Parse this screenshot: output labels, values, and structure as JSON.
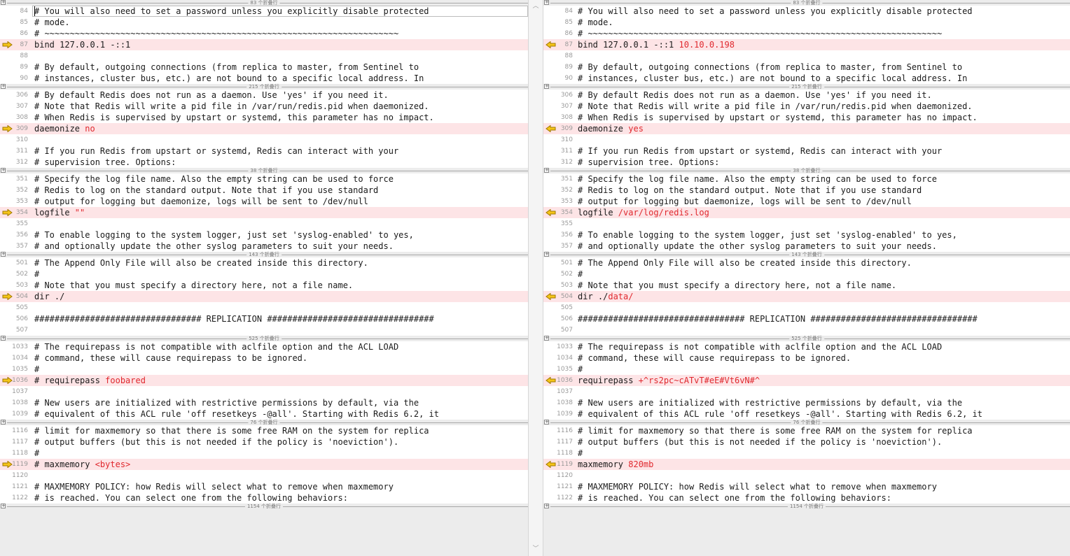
{
  "panes": {
    "left": {
      "segments": [
        {
          "folded": "83 个折叠行",
          "rows": [
            {
              "n": "84",
              "t": "# You will also need to set a password unless you explicitly disable protected",
              "d": false
            },
            {
              "n": "85",
              "t": "# mode.",
              "d": false
            },
            {
              "n": "86",
              "t": "# ~~~~~~~~~~~~~~~~~~~~~~~~~~~~~~~~~~~~~~~~~~~~~~~~~~~~~~~~~~~~~~~~~~~~~~",
              "d": false
            },
            {
              "n": "87",
              "t": "bind 127.0.0.1 -::1",
              "h": "",
              "d": true
            },
            {
              "n": "88",
              "t": "",
              "d": false
            },
            {
              "n": "89",
              "t": "# By default, outgoing connections (from replica to master, from Sentinel to",
              "d": false
            },
            {
              "n": "90",
              "t": "# instances, cluster bus, etc.) are not bound to a specific local address. In",
              "d": false
            }
          ]
        },
        {
          "folded": "215 个折叠行",
          "rows": [
            {
              "n": "306",
              "t": "# By default Redis does not run as a daemon. Use 'yes' if you need it.",
              "d": false
            },
            {
              "n": "307",
              "t": "# Note that Redis will write a pid file in /var/run/redis.pid when daemonized.",
              "d": false
            },
            {
              "n": "308",
              "t": "# When Redis is supervised by upstart or systemd, this parameter has no impact.",
              "d": false
            },
            {
              "n": "309",
              "t": "daemonize ",
              "h": "no",
              "d": true
            },
            {
              "n": "310",
              "t": "",
              "d": false
            },
            {
              "n": "311",
              "t": "# If you run Redis from upstart or systemd, Redis can interact with your",
              "d": false
            },
            {
              "n": "312",
              "t": "# supervision tree. Options:",
              "d": false
            }
          ]
        },
        {
          "folded": "38 个折叠行",
          "rows": [
            {
              "n": "351",
              "t": "# Specify the log file name. Also the empty string can be used to force",
              "d": false
            },
            {
              "n": "352",
              "t": "# Redis to log on the standard output. Note that if you use standard",
              "d": false
            },
            {
              "n": "353",
              "t": "# output for logging but daemonize, logs will be sent to /dev/null",
              "d": false
            },
            {
              "n": "354",
              "t": "logfile ",
              "h": "\"\"",
              "d": true
            },
            {
              "n": "355",
              "t": "",
              "d": false
            },
            {
              "n": "356",
              "t": "# To enable logging to the system logger, just set 'syslog-enabled' to yes,",
              "d": false
            },
            {
              "n": "357",
              "t": "# and optionally update the other syslog parameters to suit your needs.",
              "d": false
            }
          ]
        },
        {
          "folded": "143 个折叠行",
          "rows": [
            {
              "n": "501",
              "t": "# The Append Only File will also be created inside this directory.",
              "d": false
            },
            {
              "n": "502",
              "t": "#",
              "d": false
            },
            {
              "n": "503",
              "t": "# Note that you must specify a directory here, not a file name.",
              "d": false
            },
            {
              "n": "504",
              "t": "dir ./",
              "h": "",
              "d": true
            },
            {
              "n": "505",
              "t": "",
              "d": false
            },
            {
              "n": "506",
              "t": "################################# REPLICATION #################################",
              "d": false
            },
            {
              "n": "507",
              "t": "",
              "d": false
            }
          ]
        },
        {
          "folded": "525 个折叠行",
          "rows": [
            {
              "n": "1033",
              "t": "# The requirepass is not compatible with aclfile option and the ACL LOAD",
              "d": false
            },
            {
              "n": "1034",
              "t": "# command, these will cause requirepass to be ignored.",
              "d": false
            },
            {
              "n": "1035",
              "t": "#",
              "d": false
            },
            {
              "n": "1036",
              "t": "# requirepass ",
              "h": "foobared",
              "d": true
            },
            {
              "n": "1037",
              "t": "",
              "d": false
            },
            {
              "n": "1038",
              "t": "# New users are initialized with restrictive permissions by default, via the",
              "d": false
            },
            {
              "n": "1039",
              "t": "# equivalent of this ACL rule 'off resetkeys -@all'. Starting with Redis 6.2, it",
              "d": false
            }
          ]
        },
        {
          "folded": "76 个折叠行",
          "rows": [
            {
              "n": "1116",
              "t": "# limit for maxmemory so that there is some free RAM on the system for replica",
              "d": false
            },
            {
              "n": "1117",
              "t": "# output buffers (but this is not needed if the policy is 'noeviction').",
              "d": false
            },
            {
              "n": "1118",
              "t": "#",
              "d": false
            },
            {
              "n": "1119",
              "t": "# maxmemory ",
              "h": "<bytes>",
              "d": true
            },
            {
              "n": "1120",
              "t": "",
              "d": false
            },
            {
              "n": "1121",
              "t": "# MAXMEMORY POLICY: how Redis will select what to remove when maxmemory",
              "d": false
            },
            {
              "n": "1122",
              "t": "# is reached. You can select one from the following behaviors:",
              "d": false
            }
          ]
        }
      ],
      "tail_folded": "1154 个折叠行"
    },
    "right": {
      "segments": [
        {
          "folded": "83 个折叠行",
          "rows": [
            {
              "n": "84",
              "t": "# You will also need to set a password unless you explicitly disable protected",
              "d": false
            },
            {
              "n": "85",
              "t": "# mode.",
              "d": false
            },
            {
              "n": "86",
              "t": "# ~~~~~~~~~~~~~~~~~~~~~~~~~~~~~~~~~~~~~~~~~~~~~~~~~~~~~~~~~~~~~~~~~~~~~~",
              "d": false
            },
            {
              "n": "87",
              "t": "bind 127.0.0.1 -::1 ",
              "h": "10.10.0.198",
              "d": true
            },
            {
              "n": "88",
              "t": "",
              "d": false
            },
            {
              "n": "89",
              "t": "# By default, outgoing connections (from replica to master, from Sentinel to",
              "d": false
            },
            {
              "n": "90",
              "t": "# instances, cluster bus, etc.) are not bound to a specific local address. In",
              "d": false
            }
          ]
        },
        {
          "folded": "215 个折叠行",
          "rows": [
            {
              "n": "306",
              "t": "# By default Redis does not run as a daemon. Use 'yes' if you need it.",
              "d": false
            },
            {
              "n": "307",
              "t": "# Note that Redis will write a pid file in /var/run/redis.pid when daemonized.",
              "d": false
            },
            {
              "n": "308",
              "t": "# When Redis is supervised by upstart or systemd, this parameter has no impact.",
              "d": false
            },
            {
              "n": "309",
              "t": "daemonize ",
              "h": "yes",
              "d": true
            },
            {
              "n": "310",
              "t": "",
              "d": false
            },
            {
              "n": "311",
              "t": "# If you run Redis from upstart or systemd, Redis can interact with your",
              "d": false
            },
            {
              "n": "312",
              "t": "# supervision tree. Options:",
              "d": false
            }
          ]
        },
        {
          "folded": "38 个折叠行",
          "rows": [
            {
              "n": "351",
              "t": "# Specify the log file name. Also the empty string can be used to force",
              "d": false
            },
            {
              "n": "352",
              "t": "# Redis to log on the standard output. Note that if you use standard",
              "d": false
            },
            {
              "n": "353",
              "t": "# output for logging but daemonize, logs will be sent to /dev/null",
              "d": false
            },
            {
              "n": "354",
              "t": "logfile ",
              "h": "/var/log/redis.log",
              "d": true
            },
            {
              "n": "355",
              "t": "",
              "d": false
            },
            {
              "n": "356",
              "t": "# To enable logging to the system logger, just set 'syslog-enabled' to yes,",
              "d": false
            },
            {
              "n": "357",
              "t": "# and optionally update the other syslog parameters to suit your needs.",
              "d": false
            }
          ]
        },
        {
          "folded": "143 个折叠行",
          "rows": [
            {
              "n": "501",
              "t": "# The Append Only File will also be created inside this directory.",
              "d": false
            },
            {
              "n": "502",
              "t": "#",
              "d": false
            },
            {
              "n": "503",
              "t": "# Note that you must specify a directory here, not a file name.",
              "d": false
            },
            {
              "n": "504",
              "t": "dir ./",
              "h": "data/",
              "d": true
            },
            {
              "n": "505",
              "t": "",
              "d": false
            },
            {
              "n": "506",
              "t": "################################# REPLICATION #################################",
              "d": false
            },
            {
              "n": "507",
              "t": "",
              "d": false
            }
          ]
        },
        {
          "folded": "525 个折叠行",
          "rows": [
            {
              "n": "1033",
              "t": "# The requirepass is not compatible with aclfile option and the ACL LOAD",
              "d": false
            },
            {
              "n": "1034",
              "t": "# command, these will cause requirepass to be ignored.",
              "d": false
            },
            {
              "n": "1035",
              "t": "#",
              "d": false
            },
            {
              "n": "1036",
              "t": "requirepass ",
              "h": "+^rs2pc~cATvT#eE#Vt6vN#^",
              "d": true
            },
            {
              "n": "1037",
              "t": "",
              "d": false
            },
            {
              "n": "1038",
              "t": "# New users are initialized with restrictive permissions by default, via the",
              "d": false
            },
            {
              "n": "1039",
              "t": "# equivalent of this ACL rule 'off resetkeys -@all'. Starting with Redis 6.2, it",
              "d": false
            }
          ]
        },
        {
          "folded": "76 个折叠行",
          "rows": [
            {
              "n": "1116",
              "t": "# limit for maxmemory so that there is some free RAM on the system for replica",
              "d": false
            },
            {
              "n": "1117",
              "t": "# output buffers (but this is not needed if the policy is 'noeviction').",
              "d": false
            },
            {
              "n": "1118",
              "t": "#",
              "d": false
            },
            {
              "n": "1119",
              "t": "maxmemory ",
              "h": "820mb",
              "d": true
            },
            {
              "n": "1120",
              "t": "",
              "d": false
            },
            {
              "n": "1121",
              "t": "# MAXMEMORY POLICY: how Redis will select what to remove when maxmemory",
              "d": false
            },
            {
              "n": "1122",
              "t": "# is reached. You can select one from the following behaviors:",
              "d": false
            }
          ]
        }
      ],
      "tail_folded": "1154 个折叠行"
    }
  },
  "colors": {
    "diff_row_bg": "#fde4e6",
    "diff_text": "#e0282e",
    "arrow_fill": "#f5c518",
    "arrow_stroke": "#a07800"
  },
  "icons": {
    "left_change_marker": "arrow-right-icon",
    "right_change_marker": "arrow-left-icon",
    "fold_toggle": "plus-box-icon"
  }
}
